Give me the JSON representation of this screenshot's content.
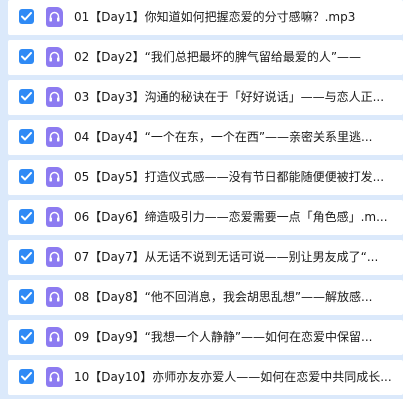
{
  "files": [
    {
      "name": "01【Day1】你知道如何把握恋爱的分寸感嘛？.mp3",
      "checked": true,
      "icon": "audio-file-icon"
    },
    {
      "name": "02【Day2】“我们总把最坏的脾气留给最爱的人”——",
      "checked": true,
      "icon": "audio-file-icon"
    },
    {
      "name": "03【Day3】沟通的秘诀在于「好好说话」——与恋人正...",
      "checked": true,
      "icon": "audio-file-icon"
    },
    {
      "name": "04【Day4】“一个在东，一个在西”——亲密关系里逃...",
      "checked": true,
      "icon": "audio-file-icon"
    },
    {
      "name": "05【Day5】打造仪式感——没有节日都能随便便被打发...",
      "checked": true,
      "icon": "audio-file-icon"
    },
    {
      "name": "06【Day6】缔造吸引力——恋爱需要一点「角色感」.m...",
      "checked": true,
      "icon": "audio-file-icon"
    },
    {
      "name": "07【Day7】从无话不说到无话可说——别让男友成了“...",
      "checked": true,
      "icon": "audio-file-icon"
    },
    {
      "name": "08【Day8】“他不回消息，我会胡思乱想”——解放感...",
      "checked": true,
      "icon": "audio-file-icon"
    },
    {
      "name": "09【Day9】“我想一个人静静”——如何在恋爱中保留...",
      "checked": true,
      "icon": "audio-file-icon"
    },
    {
      "name": "10【Day10】亦师亦友亦爱人——如何在恋爱中共同成长...",
      "checked": true,
      "icon": "audio-file-icon"
    }
  ],
  "colors": {
    "background": "#dbe9fb",
    "checkbox": "#2f8af5",
    "audio_icon": "#8d7bf1"
  }
}
